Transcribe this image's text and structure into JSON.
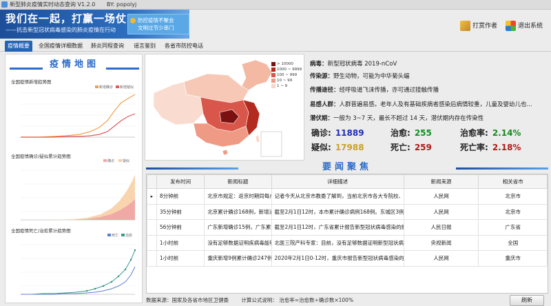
{
  "window": {
    "title": "新型肺炎疫情实时动态查询 V1.2.0",
    "author": "BY:  popolyj"
  },
  "banner": {
    "slogan": "我们在一起，打赢一场仗",
    "subtitle": "——抗击新型冠状病毒感染的肺炎疫情在行动",
    "notice_line1": "防控疫情不聚会",
    "notice_line2": "文明过节少串门"
  },
  "buttons": {
    "author": "打赏作者",
    "exit": "退出系统",
    "refresh": "刷新"
  },
  "tabs": [
    {
      "label": "疫情概要",
      "active": true
    },
    {
      "label": "全国疫情详细数据",
      "active": false
    },
    {
      "label": "肺炎同程查询",
      "active": false
    },
    {
      "label": "谣言鉴别",
      "active": false
    },
    {
      "label": "各省市防控电话",
      "active": false
    }
  ],
  "left": {
    "heading": "疫情地图",
    "charts": [
      {
        "title": "全国疫情新增趋势图",
        "legend": [
          "新增确诊",
          "新增疑似"
        ]
      },
      {
        "title": "全国疫情确诊/疑似累计趋势图",
        "legend": [
          "确诊",
          "疑似"
        ]
      },
      {
        "title": "全国疫情死亡/治愈累计趋势图",
        "legend": [
          "死亡",
          "治愈"
        ]
      }
    ]
  },
  "map": {
    "legend": [
      {
        "label": "> 10000",
        "color": "#7a1010"
      },
      {
        "label": "1000 ~ 9999",
        "color": "#b32a1f"
      },
      {
        "label": "100 ~ 999",
        "color": "#d9574a"
      },
      {
        "label": "10 ~ 99",
        "color": "#ee9a84"
      },
      {
        "label": "1 ~ 9",
        "color": "#f9d6c7"
      }
    ]
  },
  "info": {
    "virus_label": "病毒：",
    "virus": "新型冠状病毒 2019-nCoV",
    "source_label": "传染源：",
    "source": "野生动物，可能为中华菊头蝠",
    "route_label": "传播途径：",
    "route": "经呼吸道飞沫传播，亦可通过接触传播",
    "people_label": "易感人群：",
    "people": "人群普遍易感。老年人及有基础疾病者感染后病情较重，儿童及婴幼儿也...",
    "incubation_label": "潜伏期：",
    "incubation": "一般为 3~7 天，最长不超过 14 天，潜伏期内存在传染性"
  },
  "stats": {
    "confirmed_label": "确诊:",
    "confirmed": "11889",
    "suspected_label": "疑似:",
    "suspected": "17988",
    "cured_label": "治愈:",
    "cured": "255",
    "dead_label": "死亡:",
    "dead": "259",
    "cure_rate_label": "治愈率:",
    "cure_rate": "2.14%",
    "death_rate_label": "死亡率:",
    "death_rate": "2.18%",
    "colors": {
      "confirmed": "#1d2fb0",
      "suspected": "#c9a227",
      "cured": "#168b1e",
      "dead": "#b01818",
      "cure_rate": "#168b1e",
      "death_rate": "#b01818"
    }
  },
  "news": {
    "heading": "要闻聚焦",
    "columns": [
      "发布时间",
      "新闻标题",
      "详细描述",
      "新闻来源",
      "相关省市"
    ],
    "rows": [
      {
        "time": "8分钟前",
        "title": "北京市规定：返京时期同每户家...",
        "desc": "记者今天从北京市教委了解到，当前北京市各大专院校、中小学...",
        "source": "人民网",
        "region": "北京市"
      },
      {
        "time": "35分钟前",
        "title": "北京累计确诊168例，新增治愈出...",
        "desc": "截至2月1日12时，本市累计确诊病例168例。东城区3例、西城...",
        "source": "人民网",
        "region": "北京市"
      },
      {
        "time": "56分钟前",
        "title": "广东新增确诊15例，广东累计确诊...",
        "desc": "截至2月1日12时，广东省累计报告新型冠状病毒感染的肺炎确...",
        "source": "人民日报",
        "region": "广东省"
      },
      {
        "time": "1小时前",
        "title": "没有足够数据证明疾病毒能够传播风险...",
        "desc": "北医三院产科专家：目前，没有足够数据证明新型冠状病毒会...",
        "source": "央视新闻",
        "region": "全国"
      },
      {
        "time": "1小时前",
        "title": "重庆新增9例累计确诊247例",
        "desc": "2020年2月1日0-12时，重庆市报告新型冠状病毒感染的肺炎新...",
        "source": "人民网",
        "region": "重庆市"
      }
    ]
  },
  "footer": {
    "source": "数据来源：国家及各省市地区卫健委",
    "formula": "计算公式说明：  治愈率=治愈数÷确诊数×100%"
  }
}
